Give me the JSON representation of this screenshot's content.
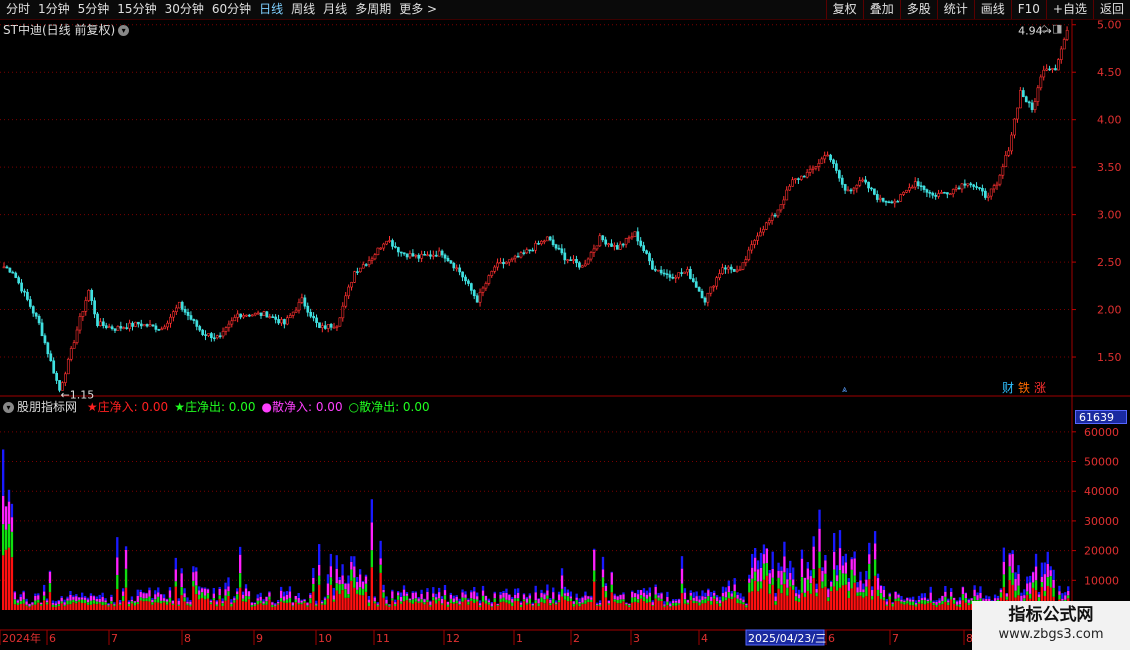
{
  "toolbar": {
    "left": [
      {
        "label": "分时",
        "active": false
      },
      {
        "label": "1分钟",
        "active": false
      },
      {
        "label": "5分钟",
        "active": false
      },
      {
        "label": "15分钟",
        "active": false
      },
      {
        "label": "30分钟",
        "active": false
      },
      {
        "label": "60分钟",
        "active": false
      },
      {
        "label": "日线",
        "active": true
      },
      {
        "label": "周线",
        "active": false
      },
      {
        "label": "月线",
        "active": false
      },
      {
        "label": "多周期",
        "active": false
      },
      {
        "label": "更多 >",
        "active": false
      }
    ],
    "right": [
      "复权",
      "叠加",
      "多股",
      "统计",
      "画线",
      "F10",
      "+自选",
      "返回"
    ]
  },
  "stock": {
    "title": "ST中迪(日线 前复权)"
  },
  "price_chart": {
    "y_ticks": [
      "5.00",
      "4.50",
      "4.00",
      "3.50",
      "3.00",
      "2.50",
      "2.00",
      "1.50"
    ],
    "y_values": [
      5.0,
      4.5,
      4.0,
      3.5,
      3.0,
      2.5,
      2.0,
      1.5
    ],
    "y_min": 1.1,
    "y_max": 5.05,
    "low_label": "←1.15",
    "low_value": 1.15,
    "high_label": "4.94→",
    "high_value": 4.94,
    "anchors": [
      [
        0,
        2.45
      ],
      [
        3,
        2.4
      ],
      [
        8,
        2.1
      ],
      [
        12,
        1.85
      ],
      [
        15,
        1.55
      ],
      [
        19,
        1.15
      ],
      [
        22,
        1.45
      ],
      [
        26,
        1.9
      ],
      [
        29,
        2.2
      ],
      [
        32,
        1.85
      ],
      [
        38,
        1.8
      ],
      [
        46,
        1.85
      ],
      [
        54,
        1.8
      ],
      [
        60,
        2.05
      ],
      [
        68,
        1.75
      ],
      [
        74,
        1.7
      ],
      [
        80,
        1.95
      ],
      [
        90,
        1.95
      ],
      [
        96,
        1.85
      ],
      [
        102,
        2.1
      ],
      [
        108,
        1.8
      ],
      [
        114,
        1.85
      ],
      [
        120,
        2.4
      ],
      [
        126,
        2.55
      ],
      [
        131,
        2.75
      ],
      [
        136,
        2.6
      ],
      [
        142,
        2.55
      ],
      [
        150,
        2.6
      ],
      [
        156,
        2.4
      ],
      [
        162,
        2.1
      ],
      [
        168,
        2.45
      ],
      [
        176,
        2.55
      ],
      [
        186,
        2.75
      ],
      [
        192,
        2.55
      ],
      [
        198,
        2.45
      ],
      [
        204,
        2.75
      ],
      [
        210,
        2.65
      ],
      [
        216,
        2.8
      ],
      [
        222,
        2.45
      ],
      [
        228,
        2.35
      ],
      [
        234,
        2.4
      ],
      [
        240,
        2.1
      ],
      [
        246,
        2.45
      ],
      [
        252,
        2.4
      ],
      [
        258,
        2.8
      ],
      [
        264,
        3.0
      ],
      [
        270,
        3.35
      ],
      [
        276,
        3.45
      ],
      [
        282,
        3.65
      ],
      [
        288,
        3.25
      ],
      [
        294,
        3.35
      ],
      [
        300,
        3.15
      ],
      [
        306,
        3.15
      ],
      [
        312,
        3.35
      ],
      [
        318,
        3.2
      ],
      [
        324,
        3.25
      ],
      [
        330,
        3.35
      ],
      [
        336,
        3.2
      ],
      [
        340,
        3.3
      ],
      [
        344,
        3.7
      ],
      [
        348,
        4.3
      ],
      [
        352,
        4.1
      ],
      [
        356,
        4.55
      ],
      [
        360,
        4.55
      ],
      [
        364,
        4.94
      ]
    ],
    "bar_count": 365
  },
  "indicator": {
    "title": "股朋指标网",
    "legend": [
      {
        "label": "★庄净入: 0.00",
        "color": "#ff2020"
      },
      {
        "label": "★庄净出: 0.00",
        "color": "#20ff20"
      },
      {
        "label": "●散净入: 0.00",
        "color": "#ff40ff"
      },
      {
        "label": "○散净出: 0.00",
        "color": "#20ff20"
      }
    ],
    "y_ticks": [
      "60000",
      "50000",
      "40000",
      "30000",
      "20000",
      "10000"
    ],
    "y_values": [
      60000,
      50000,
      40000,
      30000,
      20000,
      10000
    ],
    "y_max": 66000,
    "current_value": "61639",
    "colors": {
      "red": "#ff1010",
      "green": "#10e010",
      "magenta": "#ff20ff",
      "blue": "#1a1aff"
    }
  },
  "date_axis": {
    "labels": [
      "2024年",
      "6",
      "7",
      "8",
      "9",
      "10",
      "11",
      "12",
      "1",
      "2",
      "3",
      "4",
      "2025/04/23/三",
      "6",
      "7",
      "8"
    ],
    "highlight": "2025/04/23/三"
  },
  "badges": [
    {
      "label": "财",
      "color": "#30c0ff"
    },
    {
      "label": "铁",
      "color": "#ff6a00"
    },
    {
      "label": "涨",
      "color": "#ff3030"
    }
  ],
  "corner_icons": "◇ ◨",
  "watermark": {
    "title": "指标公式网",
    "url": "www.zbgs3.com"
  }
}
